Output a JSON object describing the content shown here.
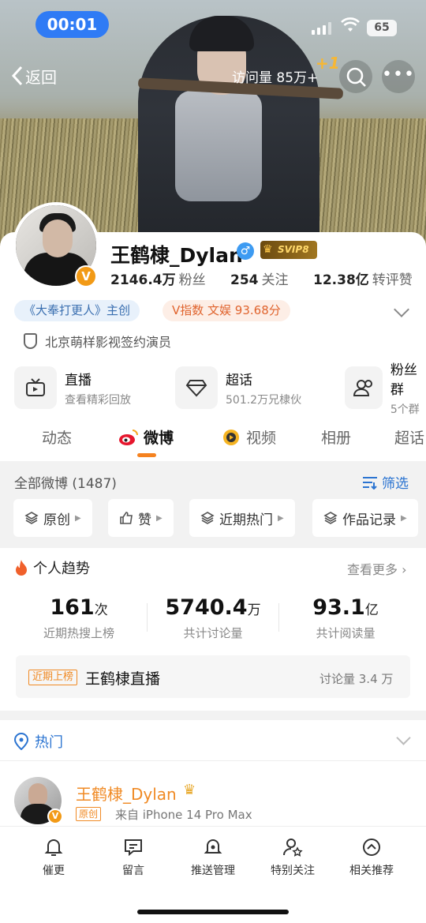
{
  "status": {
    "time": "00:01",
    "battery": "65"
  },
  "nav": {
    "back_label": "返回",
    "visits": "访问量 85万+",
    "plus_one": "+1"
  },
  "profile": {
    "name": "王鹤棣_Dylan",
    "gender_symbol": "♂",
    "svip": "SVIP8",
    "verified_mark": "V",
    "followers_count": "2146.4万",
    "followers_label": "粉丝",
    "following_count": "254",
    "following_label": "关注",
    "likes_count": "12.38亿",
    "likes_label": "转评赞",
    "tag_work": "《大奉打更人》主创",
    "tag_vindex": "V指数 文娱 93.68分",
    "verification": "北京萌样影视签约演员"
  },
  "features": [
    {
      "title": "直播",
      "sub": "查看精彩回放",
      "icon": "tv-icon"
    },
    {
      "title": "超话",
      "sub": "501.2万兄棣伙",
      "icon": "diamond-icon"
    },
    {
      "title": "粉丝群",
      "sub": "5个群",
      "icon": "group-icon"
    }
  ],
  "tabs": [
    "动态",
    "微博",
    "视频",
    "相册",
    "超话"
  ],
  "filter": {
    "all_label": "全部微博 (1487)",
    "filter_label": "筛选",
    "chips": [
      "原创",
      "赞",
      "近期热门",
      "作品记录"
    ]
  },
  "trend": {
    "title": "个人趋势",
    "see_more": "查看更多",
    "items": [
      {
        "value": "161",
        "unit": "次",
        "label": "近期热搜上榜"
      },
      {
        "value": "5740.4",
        "unit": "万",
        "label": "共计讨论量"
      },
      {
        "value": "93.1",
        "unit": "亿",
        "label": "共计阅读量"
      }
    ],
    "rank_badge": "近期上榜",
    "rank_title": "王鹤棣直播",
    "rank_discussion": "讨论量 3.4 万"
  },
  "hot": {
    "title": "热门"
  },
  "post": {
    "author": "王鹤棣_Dylan",
    "orig_badge": "原创",
    "source": "来自 iPhone 14 Pro Max"
  },
  "bottom_bar": [
    {
      "label": "催更",
      "icon": "bell-icon"
    },
    {
      "label": "留言",
      "icon": "message-icon"
    },
    {
      "label": "推送管理",
      "icon": "push-bell-icon"
    },
    {
      "label": "特别关注",
      "icon": "star-user-icon"
    },
    {
      "label": "相关推荐",
      "icon": "up-circle-icon"
    }
  ]
}
